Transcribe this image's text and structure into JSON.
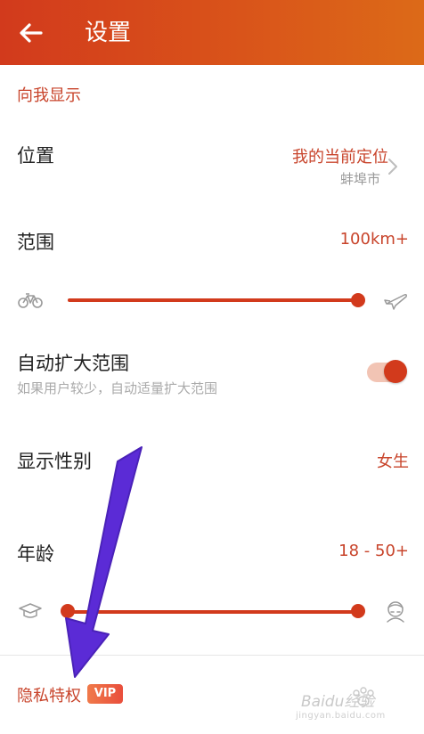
{
  "appbar": {
    "title": "设置"
  },
  "section": {
    "title": "向我显示"
  },
  "location": {
    "label": "位置",
    "value": "我的当前定位",
    "sub": "蚌埠市"
  },
  "range": {
    "label": "范围",
    "value": "100km+",
    "slider_fraction": 1.0
  },
  "auto_expand": {
    "label": "自动扩大范围",
    "hint": "如果用户较少，自动适量扩大范围",
    "enabled": true
  },
  "gender": {
    "label": "显示性别",
    "value": "女生"
  },
  "age": {
    "label": "年龄",
    "value": "18 - 50+",
    "slider_min_fraction": 0.0,
    "slider_max_fraction": 1.0
  },
  "privacy": {
    "label": "隐私特权",
    "badge": "VIP"
  },
  "watermark": {
    "text": "Baidu经验",
    "sub": "jingyan.baidu.com"
  },
  "colors": {
    "accent": "#d23a1c",
    "header_start": "#d23a1c",
    "header_end": "#dc6a18",
    "annotation_arrow": "#5b2bd6"
  },
  "icons": {
    "back": "arrow-left-icon",
    "chevron": "chevron-right-icon",
    "bicycle": "bicycle-icon",
    "airplane": "airplane-icon",
    "graduation": "graduation-cap-icon",
    "elder": "elderly-face-icon"
  }
}
